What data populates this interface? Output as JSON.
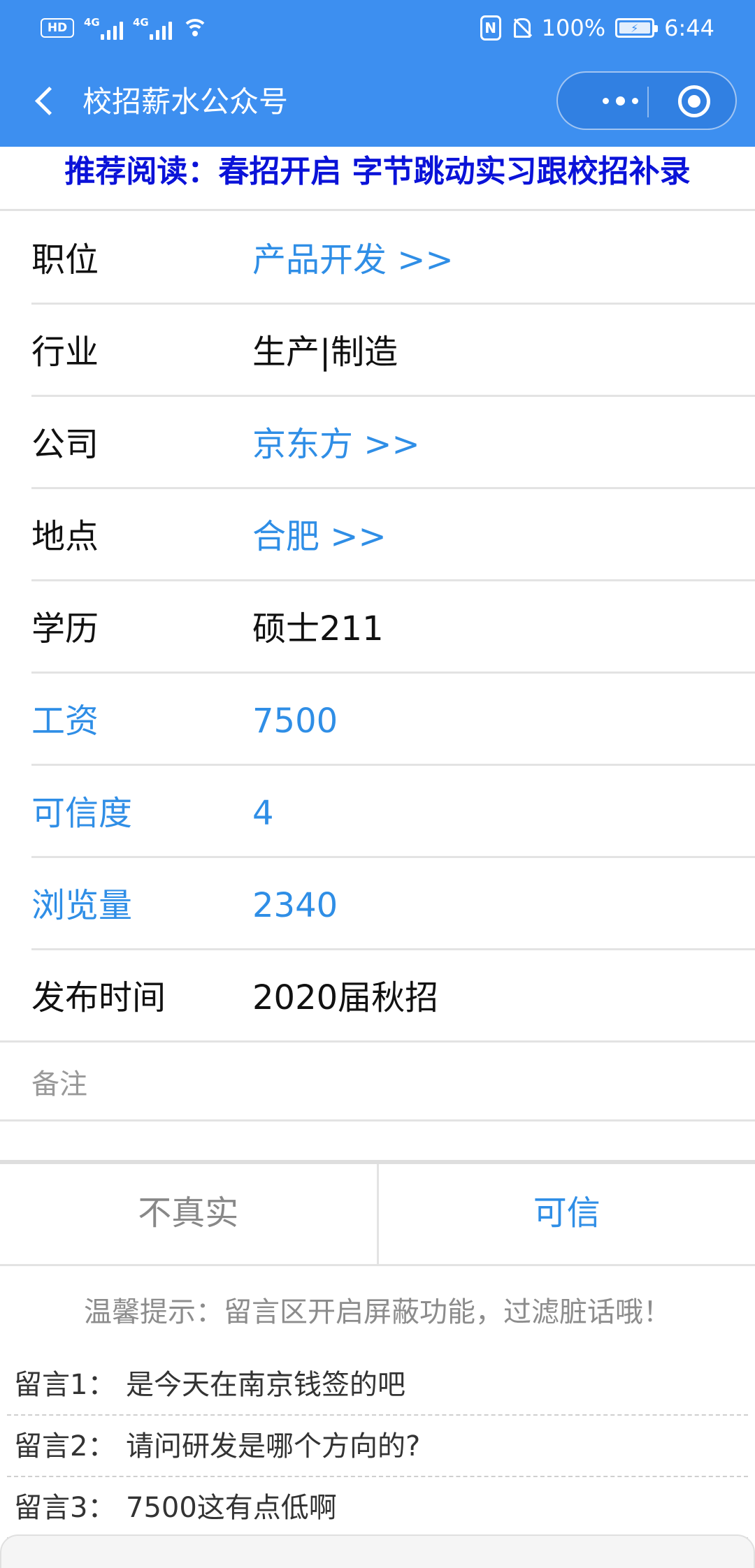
{
  "status_bar": {
    "hd_label": "HD",
    "network_1": "4G",
    "network_2": "4G",
    "nfc_label": "N",
    "battery": "100%",
    "time": "6:44"
  },
  "navbar": {
    "title": "校招薪水公众号"
  },
  "banner": {
    "text": "推荐阅读：春招开启 字节跳动实习跟校招补录"
  },
  "rows": [
    {
      "label": "职位",
      "value": "产品开发 >>"
    },
    {
      "label": "行业",
      "value": "生产|制造"
    },
    {
      "label": "公司",
      "value": "京东方 >>"
    },
    {
      "label": "地点",
      "value": "合肥 >>"
    },
    {
      "label": "学历",
      "value": "硕士211"
    },
    {
      "label": "工资",
      "value": "7500"
    },
    {
      "label": "可信度",
      "value": "4"
    },
    {
      "label": "浏览量",
      "value": "2340"
    },
    {
      "label": "发布时间",
      "value": "2020届秋招"
    }
  ],
  "remark": {
    "label": "备注"
  },
  "votes": {
    "untrue": "不真实",
    "credible": "可信"
  },
  "notice": "温馨提示：留言区开启屏蔽功能，过滤脏话哦！",
  "comments": [
    {
      "label": "留言1：",
      "text": "是今天在南京钱签的吧"
    },
    {
      "label": "留言2：",
      "text": "请问研发是哪个方向的?"
    },
    {
      "label": "留言3：",
      "text": "7500这有点低啊"
    }
  ],
  "colors": {
    "header_blue": "#3d8ff0",
    "link_blue": "#2f8ee6",
    "banner_blue": "#0a12d8"
  }
}
